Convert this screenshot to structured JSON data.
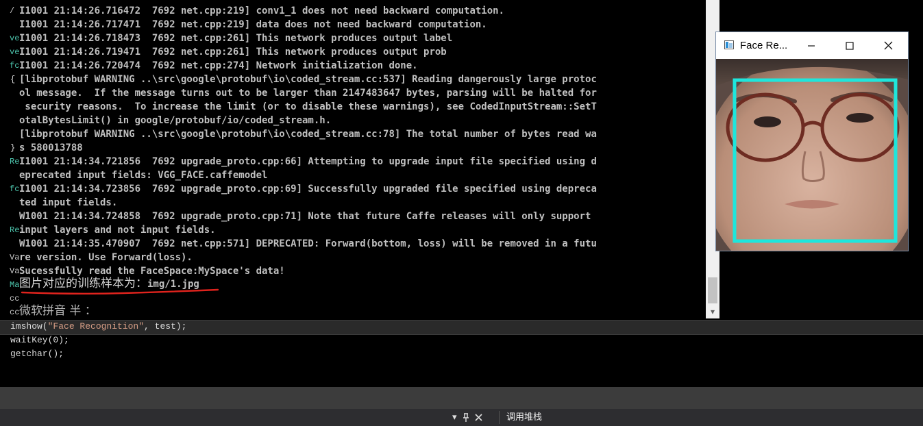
{
  "console": {
    "lines": [
      "I1001 21:14:26.716472  7692 net.cpp:219] conv1_1 does not need backward computation.",
      "I1001 21:14:26.717471  7692 net.cpp:219] data does not need backward computation.",
      "I1001 21:14:26.718473  7692 net.cpp:261] This network produces output label",
      "I1001 21:14:26.719471  7692 net.cpp:261] This network produces output prob",
      "I1001 21:14:26.720474  7692 net.cpp:274] Network initialization done.",
      "[libprotobuf WARNING ..\\src\\google\\protobuf\\io\\coded_stream.cc:537] Reading dangerously large protoc",
      "ol message.  If the message turns out to be larger than 2147483647 bytes, parsing will be halted for",
      " security reasons.  To increase the limit (or to disable these warnings), see CodedInputStream::SetT",
      "otalBytesLimit() in google/protobuf/io/coded_stream.h.",
      "[libprotobuf WARNING ..\\src\\google\\protobuf\\io\\coded_stream.cc:78] The total number of bytes read wa",
      "s 580013788",
      "I1001 21:14:34.721856  7692 upgrade_proto.cpp:66] Attempting to upgrade input file specified using d",
      "eprecated input fields: VGG_FACE.caffemodel",
      "I1001 21:14:34.723856  7692 upgrade_proto.cpp:69] Successfully upgraded file specified using depreca",
      "ted input fields.",
      "W1001 21:14:34.724858  7692 upgrade_proto.cpp:71] Note that future Caffe releases will only support",
      "input layers and not input fields.",
      "W1001 21:14:35.470907  7692 net.cpp:571] DEPRECATED: Forward(bottom, loss) will be removed in a futu",
      "re version. Use Forward(loss).",
      "Sucessfully read the FaceSpace:MySpace's data!"
    ],
    "result_label": "图片对应的训练样本为：",
    "result_value": "img/1.jpg",
    "ime_status": "微软拼音 半 ："
  },
  "gutter": {
    "fragments": [
      "/",
      "ve",
      "ve",
      "fc",
      "{",
      "}",
      "Re",
      "fc",
      "Re",
      "Va",
      "Va",
      "Ma",
      "cc",
      "cc"
    ]
  },
  "code": {
    "lines": [
      {
        "pre": "imshow(",
        "str": "\"Face Recognition\"",
        "post": ", test);"
      },
      {
        "pre": "waitKey(0);",
        "str": "",
        "post": ""
      },
      {
        "pre": "getchar();",
        "str": "",
        "post": ""
      }
    ]
  },
  "bottom_bar": {
    "call_stack_label": "调用堆栈"
  },
  "face_window": {
    "title": "Face Re..."
  },
  "colors": {
    "detection_box": "#1ee6dc",
    "underline": "#e0231d",
    "code_string": "#d69d85"
  }
}
